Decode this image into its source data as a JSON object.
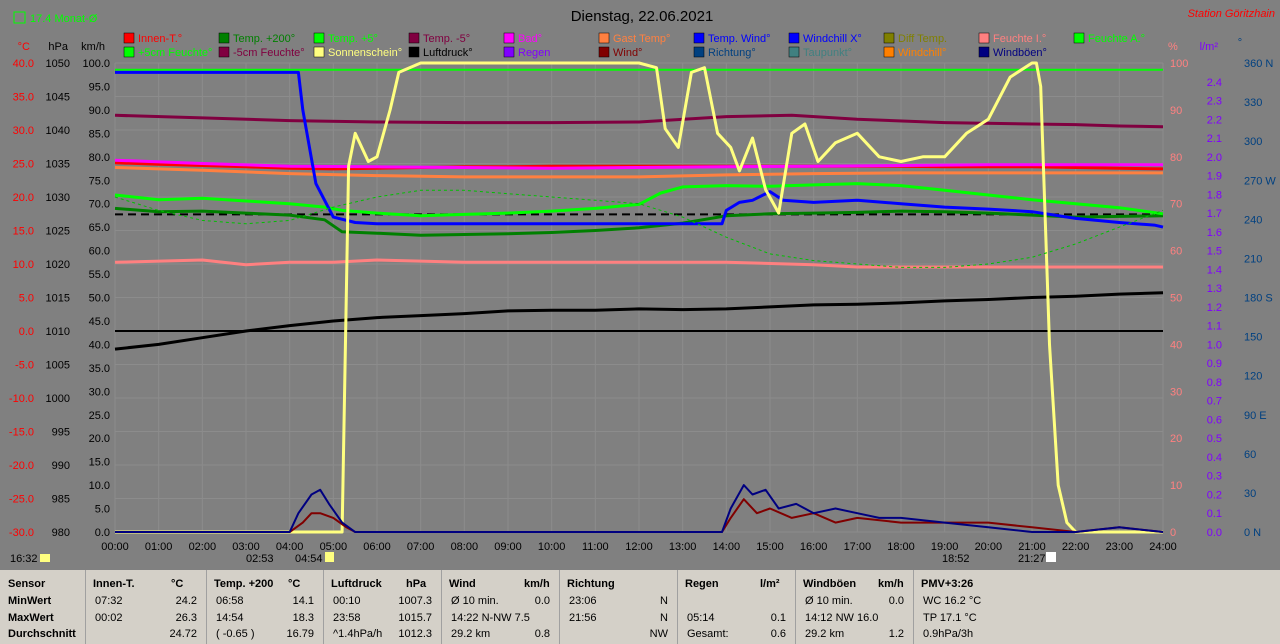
{
  "chart_data": {
    "type": "line",
    "title": "Dienstag, 22.06.2021",
    "station": "Station Göritzhain",
    "month_avg_checkbox": "17.4 Monat-Ø",
    "axes_left": {
      "temp": {
        "unit": "°C",
        "ticks": [
          "40.0",
          "35.0",
          "30.0",
          "25.0",
          "20.0",
          "15.0",
          "10.0",
          "5.0",
          "0.0",
          "-5.0",
          "-10.0",
          "-15.0",
          "-20.0",
          "-25.0",
          "-30.0"
        ]
      },
      "pressure": {
        "unit": "hPa",
        "ticks": [
          "1050",
          "1045",
          "1040",
          "1035",
          "1030",
          "1025",
          "1020",
          "1015",
          "1010",
          "1005",
          "1000",
          "995",
          "990",
          "985",
          "980"
        ]
      },
      "speed": {
        "unit": "km/h",
        "ticks": [
          "100.0",
          "95.0",
          "90.0",
          "85.0",
          "80.0",
          "75.0",
          "70.0",
          "65.0",
          "60.0",
          "55.0",
          "50.0",
          "45.0",
          "40.0",
          "35.0",
          "30.0",
          "25.0",
          "20.0",
          "15.0",
          "10.0",
          "5.0",
          "0.0"
        ]
      }
    },
    "axes_right": {
      "humidity": {
        "unit": "%",
        "ticks": [
          "100",
          "90",
          "80",
          "70",
          "60",
          "50",
          "40",
          "30",
          "20",
          "10",
          "0"
        ]
      },
      "rain": {
        "unit": "l/m²",
        "ticks": [
          "2.4",
          "2.3",
          "2.2",
          "2.1",
          "2.0",
          "1.9",
          "1.8",
          "1.7",
          "1.6",
          "1.5",
          "1.4",
          "1.3",
          "1.2",
          "1.1",
          "1.0",
          "0.9",
          "0.8",
          "0.7",
          "0.6",
          "0.5",
          "0.4",
          "0.3",
          "0.2",
          "0.1",
          "0.0"
        ]
      },
      "direction": {
        "unit": "°",
        "ticks": [
          "360 N",
          "330",
          "300",
          "270 W",
          "240",
          "210",
          "180 S",
          "150",
          "120",
          "90 E",
          "60",
          "30",
          "0 N"
        ]
      }
    },
    "x_ticks": [
      "00:00",
      "01:00",
      "02:00",
      "03:00",
      "04:00",
      "05:00",
      "06:00",
      "07:00",
      "08:00",
      "09:00",
      "10:00",
      "11:00",
      "12:00",
      "13:00",
      "14:00",
      "15:00",
      "16:00",
      "17:00",
      "18:00",
      "19:00",
      "20:00",
      "21:00",
      "22:00",
      "23:00",
      "24:00"
    ],
    "markers": {
      "left_time": "16:32",
      "sunrise": "02:53",
      "sunrise2": "04:54",
      "sunset": "18:52",
      "sunset2": "21:27"
    },
    "legend": [
      {
        "name": "Innen-T.°",
        "color": "#ff0000"
      },
      {
        "name": "Temp. +200°",
        "color": "#008000"
      },
      {
        "name": "Temp. +5°",
        "color": "#00ff00"
      },
      {
        "name": "Temp. -5°",
        "color": "#800040"
      },
      {
        "name": "Bad°",
        "color": "#ff00ff"
      },
      {
        "name": "Gast Temp°",
        "color": "#ff8040"
      },
      {
        "name": "Temp. Wind°",
        "color": "#0000ff"
      },
      {
        "name": "Windchill X°",
        "color": "#0000ff"
      },
      {
        "name": "Diff Temp.",
        "color": "#808000"
      },
      {
        "name": "Feuchte I.°",
        "color": "#ff8080"
      },
      {
        "name": "Feuchte A.°",
        "color": "#00ff00"
      },
      {
        "name": "+5cm Feuchte°",
        "color": "#00ff00"
      },
      {
        "name": "-5cm Feuchte°",
        "color": "#800040"
      },
      {
        "name": "Sonnenschein°",
        "color": "#ffff80"
      },
      {
        "name": "Luftdruck°",
        "color": "#000000"
      },
      {
        "name": "Regen",
        "color": "#8000ff"
      },
      {
        "name": "Wind°",
        "color": "#800000"
      },
      {
        "name": "Richtung°",
        "color": "#004080"
      },
      {
        "name": "Taupunkt°",
        "color": "#408080"
      },
      {
        "name": "Windchill°",
        "color": "#ff8000"
      },
      {
        "name": "Windböen°",
        "color": "#000080"
      }
    ],
    "series": [
      {
        "name": "Innen-T.°",
        "color": "#ff0000",
        "x": [
          0,
          1,
          2,
          3,
          4,
          5,
          6,
          7,
          8,
          9,
          10,
          11,
          12,
          13,
          14,
          15,
          16,
          17,
          18,
          19,
          20,
          21,
          22,
          23,
          24
        ],
        "values": [
          25.1,
          24.9,
          24.7,
          24.5,
          24.3,
          24.2,
          24.3,
          24.4,
          24.5,
          24.5,
          24.6,
          24.6,
          24.6,
          24.6,
          24.6,
          24.6,
          24.6,
          24.6,
          24.6,
          24.5,
          24.5,
          24.5,
          24.4,
          24.3,
          24.2
        ]
      },
      {
        "name": "Temp. +200°",
        "color": "#008000",
        "x": [
          0,
          1,
          2,
          3,
          4,
          4.8,
          5.2,
          6,
          7,
          8,
          9,
          10,
          11,
          12,
          13,
          14,
          15,
          16,
          17,
          18,
          19,
          20,
          21,
          22,
          23,
          24
        ],
        "values": [
          18.3,
          17.8,
          17.9,
          17.6,
          17.3,
          16.6,
          14.8,
          14.6,
          14.3,
          14.4,
          14.5,
          14.7,
          15.0,
          15.4,
          16.1,
          17.2,
          17.5,
          17.6,
          17.7,
          17.9,
          17.8,
          17.6,
          17.3,
          17.0,
          17.1,
          17.2
        ]
      },
      {
        "name": "Temp. +5°",
        "color": "#00ff00",
        "x": [
          0,
          1,
          2,
          3,
          4,
          4.8,
          5.2,
          6,
          7,
          8,
          9,
          10,
          11,
          12,
          12.5,
          13,
          14,
          15,
          16,
          17,
          18,
          19,
          20,
          21,
          22,
          23,
          24
        ],
        "values": [
          20.3,
          19.6,
          19.8,
          19.4,
          19.0,
          18.5,
          18.0,
          17.6,
          17.2,
          17.4,
          17.6,
          17.9,
          18.3,
          18.9,
          20.6,
          21.5,
          21.7,
          21.6,
          21.8,
          22.0,
          21.7,
          21.0,
          20.3,
          19.6,
          19.0,
          18.4,
          17.5
        ]
      },
      {
        "name": "Bad°",
        "color": "#ff00ff",
        "x": [
          0,
          2,
          4,
          6,
          8,
          10,
          12,
          14,
          16,
          18,
          20,
          22,
          24
        ],
        "values": [
          25.5,
          25.0,
          24.6,
          24.5,
          24.4,
          24.3,
          24.4,
          24.5,
          24.6,
          24.7,
          24.8,
          24.8,
          24.8
        ]
      },
      {
        "name": "Gast Temp°",
        "color": "#ff8040",
        "x": [
          0,
          2,
          4,
          6,
          8,
          10,
          12,
          14,
          16,
          18,
          20,
          22,
          24
        ],
        "values": [
          24.4,
          24.0,
          23.5,
          23.2,
          23.0,
          23.0,
          23.0,
          23.3,
          23.5,
          23.6,
          23.6,
          23.6,
          23.6
        ]
      },
      {
        "name": "Temp. -5°",
        "color": "#800040",
        "x": [
          0,
          2,
          4,
          6,
          8,
          10,
          12,
          14,
          15.5,
          17,
          19,
          21,
          22,
          23,
          24
        ],
        "values": [
          32.2,
          31.8,
          31.4,
          31.2,
          31.1,
          31.1,
          31.2,
          32.0,
          32.2,
          31.6,
          31.1,
          30.9,
          30.8,
          30.6,
          30.5
        ]
      },
      {
        "name": "Windchill X°",
        "color": "#0000ff",
        "x": [
          0,
          4.2,
          4.3,
          4.6,
          5.0,
          5.5,
          6,
          7,
          8,
          9,
          10,
          11,
          12,
          13,
          13.9,
          14.0,
          14.3,
          14.6,
          15.0,
          15.3,
          16,
          17,
          18,
          19,
          20,
          21,
          22,
          23,
          23.8,
          24
        ],
        "values": [
          38.6,
          38.6,
          33.0,
          22.0,
          17.0,
          16.2,
          16.0,
          16.0,
          16.0,
          16.0,
          16.0,
          16.0,
          16.0,
          16.0,
          16.0,
          18.0,
          19.2,
          19.5,
          20.8,
          19.5,
          19.2,
          19.5,
          19.0,
          18.5,
          18.2,
          17.8,
          16.8,
          16.2,
          15.8,
          15.5
        ]
      },
      {
        "name": "Feuchte I.°",
        "color": "#ff8080",
        "x": [
          0,
          2,
          3,
          4,
          5,
          6,
          8,
          10,
          12,
          14,
          16,
          17,
          18,
          20,
          22,
          24
        ],
        "values": [
          57.5,
          58.0,
          57.0,
          57.5,
          57.5,
          58.0,
          57.5,
          57.5,
          57.5,
          57.5,
          57.0,
          56.5,
          56.5,
          56.5,
          56.5,
          56.5
        ]
      },
      {
        "name": "Luftdruck°",
        "color": "#000000",
        "x": [
          0,
          1,
          2,
          3,
          4,
          5,
          6,
          7,
          8,
          9,
          10,
          11,
          12,
          13,
          14,
          15,
          16,
          17,
          18,
          19,
          20,
          21,
          22,
          23,
          24
        ],
        "values": [
          1007.3,
          1008.0,
          1009.0,
          1010.0,
          1010.8,
          1011.5,
          1012.0,
          1012.3,
          1012.6,
          1013.0,
          1013.1,
          1013.1,
          1013.3,
          1013.2,
          1013.3,
          1013.6,
          1013.9,
          1014.0,
          1014.2,
          1014.5,
          1014.7,
          1015.0,
          1015.2,
          1015.5,
          1015.7
        ]
      },
      {
        "name": "Sonnenschein°",
        "color": "#ffff80",
        "x": [
          0,
          5.0,
          5.2,
          5.35,
          5.5,
          5.8,
          6.0,
          6.3,
          6.5,
          7,
          8,
          9,
          10,
          11,
          12,
          12.4,
          12.6,
          12.9,
          13.2,
          13.5,
          13.8,
          14.1,
          14.3,
          14.6,
          14.9,
          15.2,
          15.5,
          15.8,
          16.1,
          16.5,
          17,
          17.5,
          18,
          18.5,
          19,
          19.5,
          20,
          20.5,
          21,
          21.1,
          21.2,
          21.4,
          21.6,
          21.8,
          22,
          24
        ],
        "values": [
          0,
          0,
          0,
          78,
          85,
          79,
          80,
          90,
          98,
          100,
          100,
          100,
          100,
          100,
          100,
          99,
          86,
          82,
          98,
          99,
          85,
          82,
          77,
          84,
          73,
          68,
          85,
          87,
          79,
          83,
          85,
          80,
          79,
          80,
          80,
          85,
          88,
          97,
          100,
          100,
          95,
          40,
          10,
          2,
          0,
          0
        ]
      },
      {
        "name": "Wind°",
        "color": "#800000",
        "x": [
          0,
          4.0,
          4.3,
          4.5,
          4.7,
          5.0,
          5.3,
          5.5,
          13.9,
          14.1,
          14.4,
          14.7,
          15.0,
          15.5,
          16.0,
          16.5,
          17.0,
          18.0,
          19.0,
          20.0,
          21.0,
          22.0,
          23.0,
          24
        ],
        "values": [
          0,
          0,
          2,
          4,
          4,
          3,
          1,
          0,
          0,
          3,
          7,
          4,
          5,
          3,
          4,
          2,
          3,
          2,
          2,
          2,
          1,
          0,
          1,
          0
        ]
      },
      {
        "name": "Windböen°",
        "color": "#000080",
        "x": [
          0,
          4.0,
          4.2,
          4.5,
          4.7,
          4.9,
          5.2,
          5.5,
          13.9,
          14.1,
          14.4,
          14.6,
          14.9,
          15.2,
          15.6,
          16.0,
          16.5,
          17.0,
          17.5,
          18.0,
          19.0,
          20.0,
          21.0,
          22.0,
          23.0,
          24
        ],
        "values": [
          0,
          0,
          4,
          8,
          9,
          6,
          2,
          0,
          0,
          5,
          10,
          8,
          9,
          5,
          6,
          4,
          5,
          4,
          3,
          3,
          2,
          1,
          0,
          0,
          1,
          0
        ]
      },
      {
        "name": "Feuchte A.° (dashed)",
        "color": "#00c000",
        "x": [
          0,
          1,
          2,
          3,
          4,
          5,
          6,
          7,
          8,
          9,
          10,
          11,
          12,
          13,
          14,
          15,
          16,
          17,
          18,
          19,
          20,
          21,
          22,
          23,
          24
        ],
        "values": [
          20.0,
          18.0,
          16.5,
          16.0,
          16.5,
          18.5,
          20.0,
          21.0,
          21.0,
          20.5,
          20.0,
          19.5,
          19.0,
          17.0,
          14.0,
          11.5,
          10.5,
          10.0,
          9.5,
          9.5,
          10.0,
          11.0,
          13.0,
          15.5,
          18.0
        ]
      }
    ],
    "reference_lines": [
      {
        "name": "month-average",
        "value": 17.4,
        "unit": "°C",
        "color": "#000000",
        "style": "dashed"
      },
      {
        "name": "zero-line",
        "value": 0.0,
        "unit": "°C",
        "color": "#000000",
        "style": "solid"
      },
      {
        "name": "max-line",
        "value": 39.0,
        "unit": "°C",
        "color": "#00ff00",
        "style": "solid"
      }
    ]
  },
  "table": {
    "row_labels": [
      "Sensor",
      "MinWert",
      "MaxWert",
      "Durchschnitt"
    ],
    "columns": [
      {
        "header": "Innen-T.",
        "unit": "°C",
        "rows": [
          [
            "07:32",
            "24.2"
          ],
          [
            "00:02",
            "26.3"
          ],
          [
            "",
            "24.72"
          ]
        ]
      },
      {
        "header": "Temp. +200",
        "unit": "°C",
        "rows": [
          [
            "06:58",
            "14.1"
          ],
          [
            "14:54",
            "18.3"
          ],
          [
            "( -0.65 )",
            "16.79"
          ]
        ]
      },
      {
        "header": "Luftdruck",
        "unit": "hPa",
        "rows": [
          [
            "00:10",
            "1007.3"
          ],
          [
            "23:58",
            "1015.7"
          ],
          [
            "^1.4hPa/h",
            "1012.3"
          ]
        ]
      },
      {
        "header": "Wind",
        "unit": "km/h",
        "rows": [
          [
            "Ø 10 min.",
            "0.0"
          ],
          [
            "14:22  N-NW 7.5",
            ""
          ],
          [
            "29.2 km",
            "0.8"
          ]
        ]
      },
      {
        "header": "Richtung",
        "unit": "",
        "rows": [
          [
            "23:06",
            "N"
          ],
          [
            "21:56",
            "N"
          ],
          [
            "",
            "NW"
          ]
        ]
      },
      {
        "header": "Regen",
        "unit": "l/m²",
        "rows": [
          [
            "",
            ""
          ],
          [
            "05:14",
            "0.1"
          ],
          [
            "Gesamt:",
            "0.6"
          ]
        ]
      },
      {
        "header": "Windböen",
        "unit": "km/h",
        "rows": [
          [
            "Ø 10 min.",
            "0.0"
          ],
          [
            "14:12  NW 16.0",
            ""
          ],
          [
            "29.2 km",
            "1.2"
          ]
        ]
      },
      {
        "header": "PMV+3:26",
        "unit": "",
        "rows": [
          [
            "WC 16.2 °C",
            ""
          ],
          [
            "TP 17.1 °C",
            ""
          ],
          [
            "0.9hPa/3h",
            ""
          ]
        ]
      }
    ]
  }
}
